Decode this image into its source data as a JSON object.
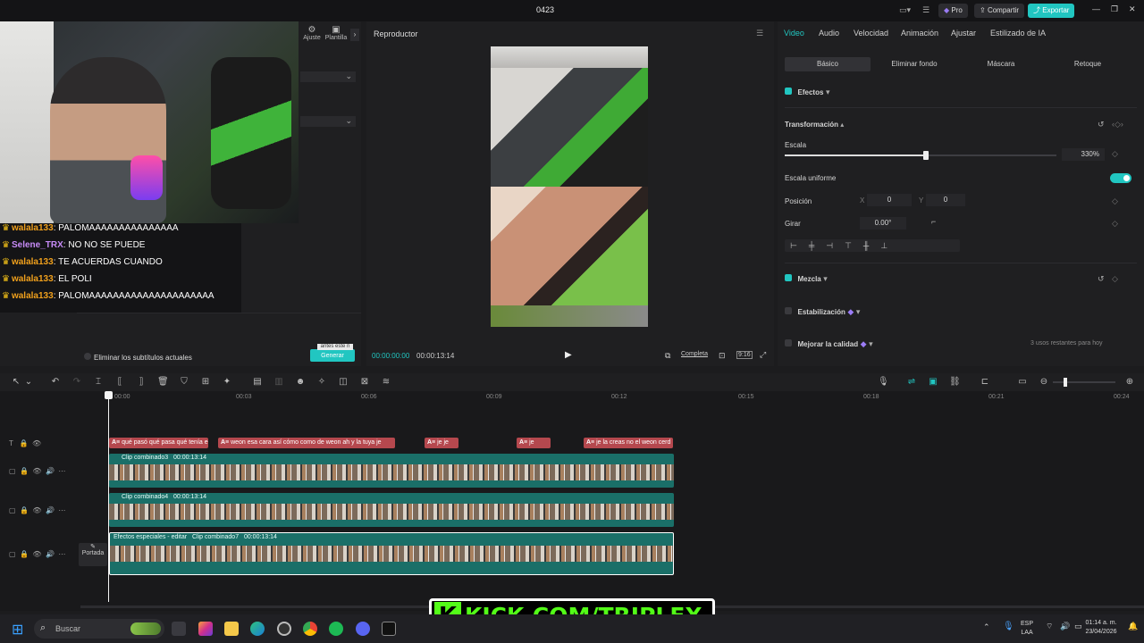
{
  "app": {
    "project_name": "0423",
    "pro_label": "Pro",
    "share_label": "Compartir",
    "export_label": "Exportar"
  },
  "left_panel": {
    "tools": [
      {
        "label": "Ajuste"
      },
      {
        "label": "Plantilla"
      }
    ],
    "remove_subtitles_label": "Eliminar los subtítulos actuales",
    "generate_label": "Generar",
    "generate_note": "antes este n"
  },
  "chat": [
    {
      "user": "walala133",
      "message": "PALOMAAAAAAAAAAAAAAA",
      "color": "#f0a01c"
    },
    {
      "user": "Selene_TRX",
      "message": "NO NO SE PUEDE",
      "color": "#c78bf7"
    },
    {
      "user": "walala133",
      "message": "TE ACUERDAS CUANDO",
      "color": "#f0a01c"
    },
    {
      "user": "walala133",
      "message": "EL POLI",
      "color": "#f0a01c"
    },
    {
      "user": "walala133",
      "message": "PALOMAAAAAAAAAAAAAAAAAAAAA",
      "color": "#f0a01c"
    }
  ],
  "player": {
    "title": "Reproductor",
    "current_time": "00:00:00:00",
    "total_time": "00:00:13:14",
    "full_label": "Completa",
    "ratio_label": "9:16"
  },
  "right_panel": {
    "tabs": [
      "Video",
      "Audio",
      "Velocidad",
      "Animación",
      "Ajustar",
      "Estilizado de IA"
    ],
    "active_tab": "Video",
    "sub_tabs": [
      "Básico",
      "Eliminar fondo",
      "Máscara",
      "Retoque"
    ],
    "effects_label": "Efectos",
    "transform_label": "Transformación",
    "scale_label": "Escala",
    "scale_value": "330%",
    "scale_fraction": 0.52,
    "uniform_scale_label": "Escala uniforme",
    "position_label": "Posición",
    "x_label": "X",
    "x_value": "0",
    "y_label": "Y",
    "y_value": "0",
    "rotate_label": "Girar",
    "rotate_value": "0.00°",
    "blend_label": "Mezcla",
    "stabilize_label": "Estabilización",
    "enhance_label": "Mejorar la calidad",
    "enhance_note": "3 usos restantes para hoy",
    "accent_color": "#21c6c1"
  },
  "timeline": {
    "ruler": [
      "00:00",
      "00:03",
      "00:06",
      "00:09",
      "00:12",
      "00:15",
      "00:18",
      "00:21",
      "00:24"
    ],
    "captions": [
      {
        "text": "qué pasó qué pasa qué tenía e"
      },
      {
        "text": "weon esa cara así cómo como de weon ah y la tuya je"
      },
      {
        "text": "je je"
      },
      {
        "text": "je"
      },
      {
        "text": "je la creas no el weon cerd"
      }
    ],
    "tracks": [
      {
        "label": "Clip combinado3",
        "duration": "00:00:13:14"
      },
      {
        "label": "Clip combinado4",
        "duration": "00:00:13:14"
      },
      {
        "label": "Clip combinado7",
        "duration": "00:00:13:14",
        "effect": "Efectos especiales - editar"
      }
    ],
    "cover_label": "Portada"
  },
  "taskbar": {
    "search_placeholder": "Buscar",
    "language": "ESP",
    "layout": "LAA",
    "time": "01:14 a. m.",
    "date": "23/04/2026"
  },
  "overlay": {
    "kick_text": "KICK.COM/TRIPLEX"
  }
}
